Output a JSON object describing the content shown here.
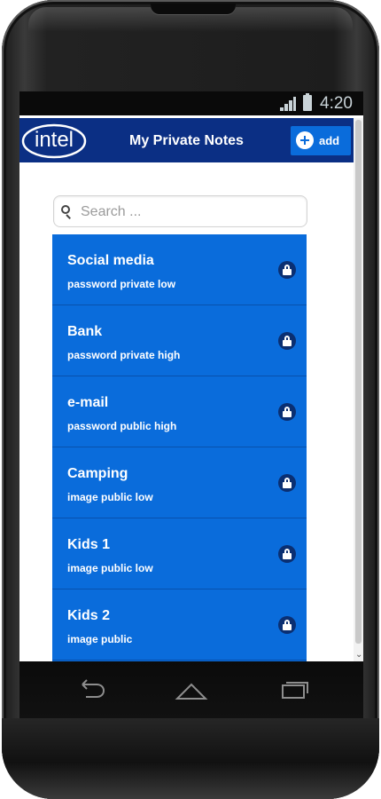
{
  "status_bar": {
    "time": "4:20"
  },
  "header": {
    "logo_text": "intel",
    "title": "My Private Notes",
    "add_label": "add"
  },
  "search": {
    "placeholder": "Search ..."
  },
  "notes": [
    {
      "title": "Social media",
      "tags": "password private low"
    },
    {
      "title": "Bank",
      "tags": "password private high"
    },
    {
      "title": "e-mail",
      "tags": "password public high"
    },
    {
      "title": "Camping",
      "tags": "image public low"
    },
    {
      "title": "Kids 1",
      "tags": "image public low"
    },
    {
      "title": "Kids 2",
      "tags": "image public"
    }
  ],
  "colors": {
    "header": "#0b2f84",
    "list_item": "#0a6cdb",
    "list_divider": "#0751ad",
    "lock_badge": "#0a2f72"
  }
}
